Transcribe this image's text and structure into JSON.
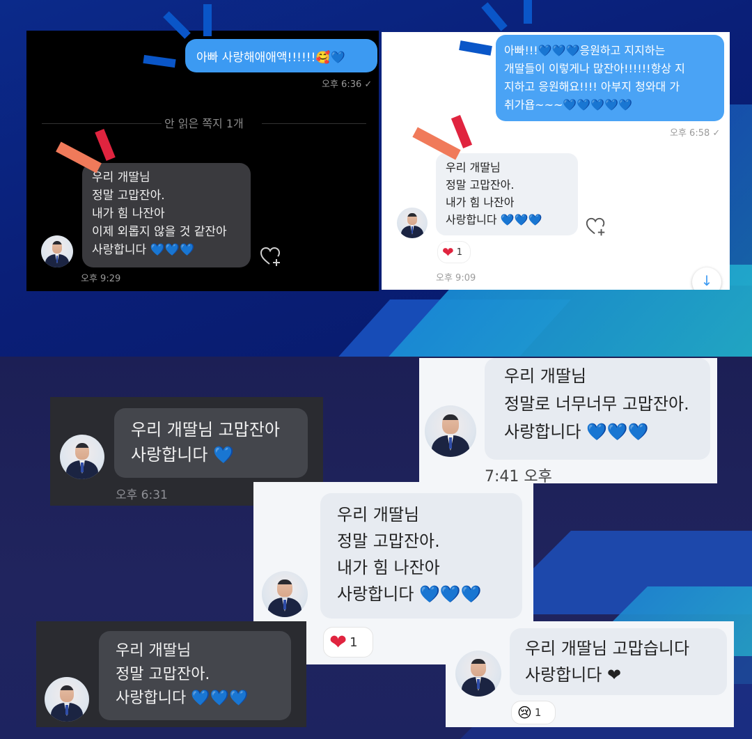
{
  "colors": {
    "my_bubble": "#3c9af2",
    "dark_panel": "#000000",
    "dark_bubble": "#3a3a3e",
    "light_bubble": "#eef1f5",
    "accent_red": "#e0243f",
    "accent_blue": "#0a56c8"
  },
  "panel1": {
    "my_message": "아빠 사랑해애애액!!!!!!🥰💙",
    "my_time": "오후 6:36 ✓",
    "unread_divider": "안 읽은 쪽지 1개",
    "reply": "우리 개딸님\n정말 고맙잔아.\n내가 힘 나잔아\n이제 외롭지 않을 것 같잔아\n사랑합니다 💙💙💙",
    "reply_time": "오후 9:29",
    "icon": "heart-plus-icon"
  },
  "panel2": {
    "my_message": "아빠!!!💙💙💙응원하고 지지하는\n개딸들이 이렇게나 많잔아!!!!!!항상 지\n지하고 응원해요!!!! 아부지 청와대 가\n취가욥~~~💙💙💙💙💙",
    "my_time": "오후 6:58 ✓",
    "reply": "우리 개딸님\n정말 고맙잔아.\n내가 힘 나잔아\n사랑합니다 💙💙💙",
    "reaction_emoji": "❤",
    "reaction_count": "1",
    "reply_time": "오후 9:09",
    "scroll_icon": "arrow-down-icon"
  },
  "bottom": {
    "card_a": {
      "text": "우리 개딸님 고맙잔아\n사랑합니다 💙",
      "time": "오후 6:31"
    },
    "card_b": {
      "text": "우리 개딸님\n정말로 너무너무 고맙잔아.\n사랑합니다 💙💙💙",
      "time": "7:41 오후"
    },
    "card_c": {
      "text": "우리 개딸님\n정말 고맙잔아.\n내가 힘 나잔아\n사랑합니다 💙💙💙",
      "reaction_emoji": "❤",
      "reaction_count": "1"
    },
    "card_d": {
      "text": "우리 개딸님\n정말 고맙잔아.\n사랑합니다 💙💙💙"
    },
    "card_e": {
      "text": "우리 개딸님 고맙습니다\n사랑합니다 ❤",
      "reaction_emoji": "😢",
      "reaction_count": "1"
    }
  }
}
